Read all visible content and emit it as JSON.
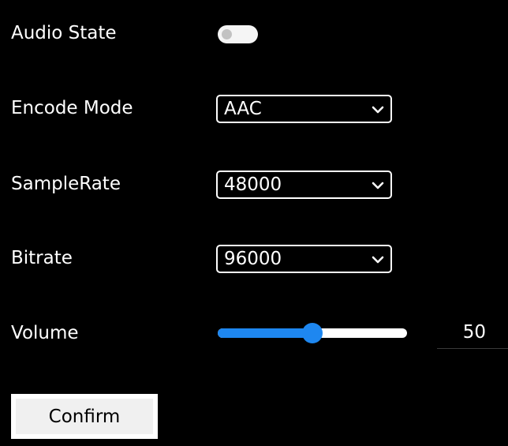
{
  "audio_state": {
    "label": "Audio State",
    "enabled": false
  },
  "encode_mode": {
    "label": "Encode Mode",
    "selected": "AAC"
  },
  "sample_rate": {
    "label": "SampleRate",
    "selected": "48000"
  },
  "bitrate": {
    "label": "Bitrate",
    "selected": "96000"
  },
  "volume": {
    "label": "Volume",
    "value": "50",
    "min": 0,
    "max": 100
  },
  "confirm_label": "Confirm",
  "colors": {
    "background": "#000000",
    "accent": "#1e87f0",
    "text": "#ffffff"
  },
  "icons": {
    "select_arrow": "chevron-down-icon"
  }
}
